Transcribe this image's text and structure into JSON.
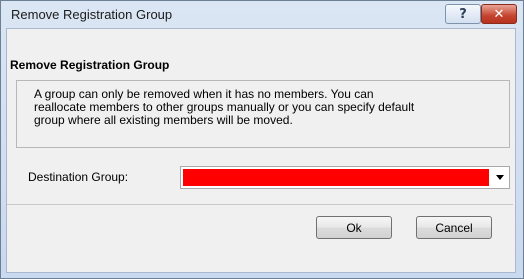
{
  "window": {
    "title": "Remove Registration Group",
    "help_glyph": "?",
    "close_glyph": "✕"
  },
  "section": {
    "title": "Remove Registration Group"
  },
  "info": {
    "line1": "A group can only be removed when it has no members. You can",
    "line2": "reallocate members to other groups manually or you can specify default",
    "line3": "group where all existing members will be moved."
  },
  "destination": {
    "label": "Destination Group:",
    "value": "",
    "highlight_color": "#ff0000"
  },
  "buttons": {
    "ok": "Ok",
    "cancel": "Cancel"
  }
}
